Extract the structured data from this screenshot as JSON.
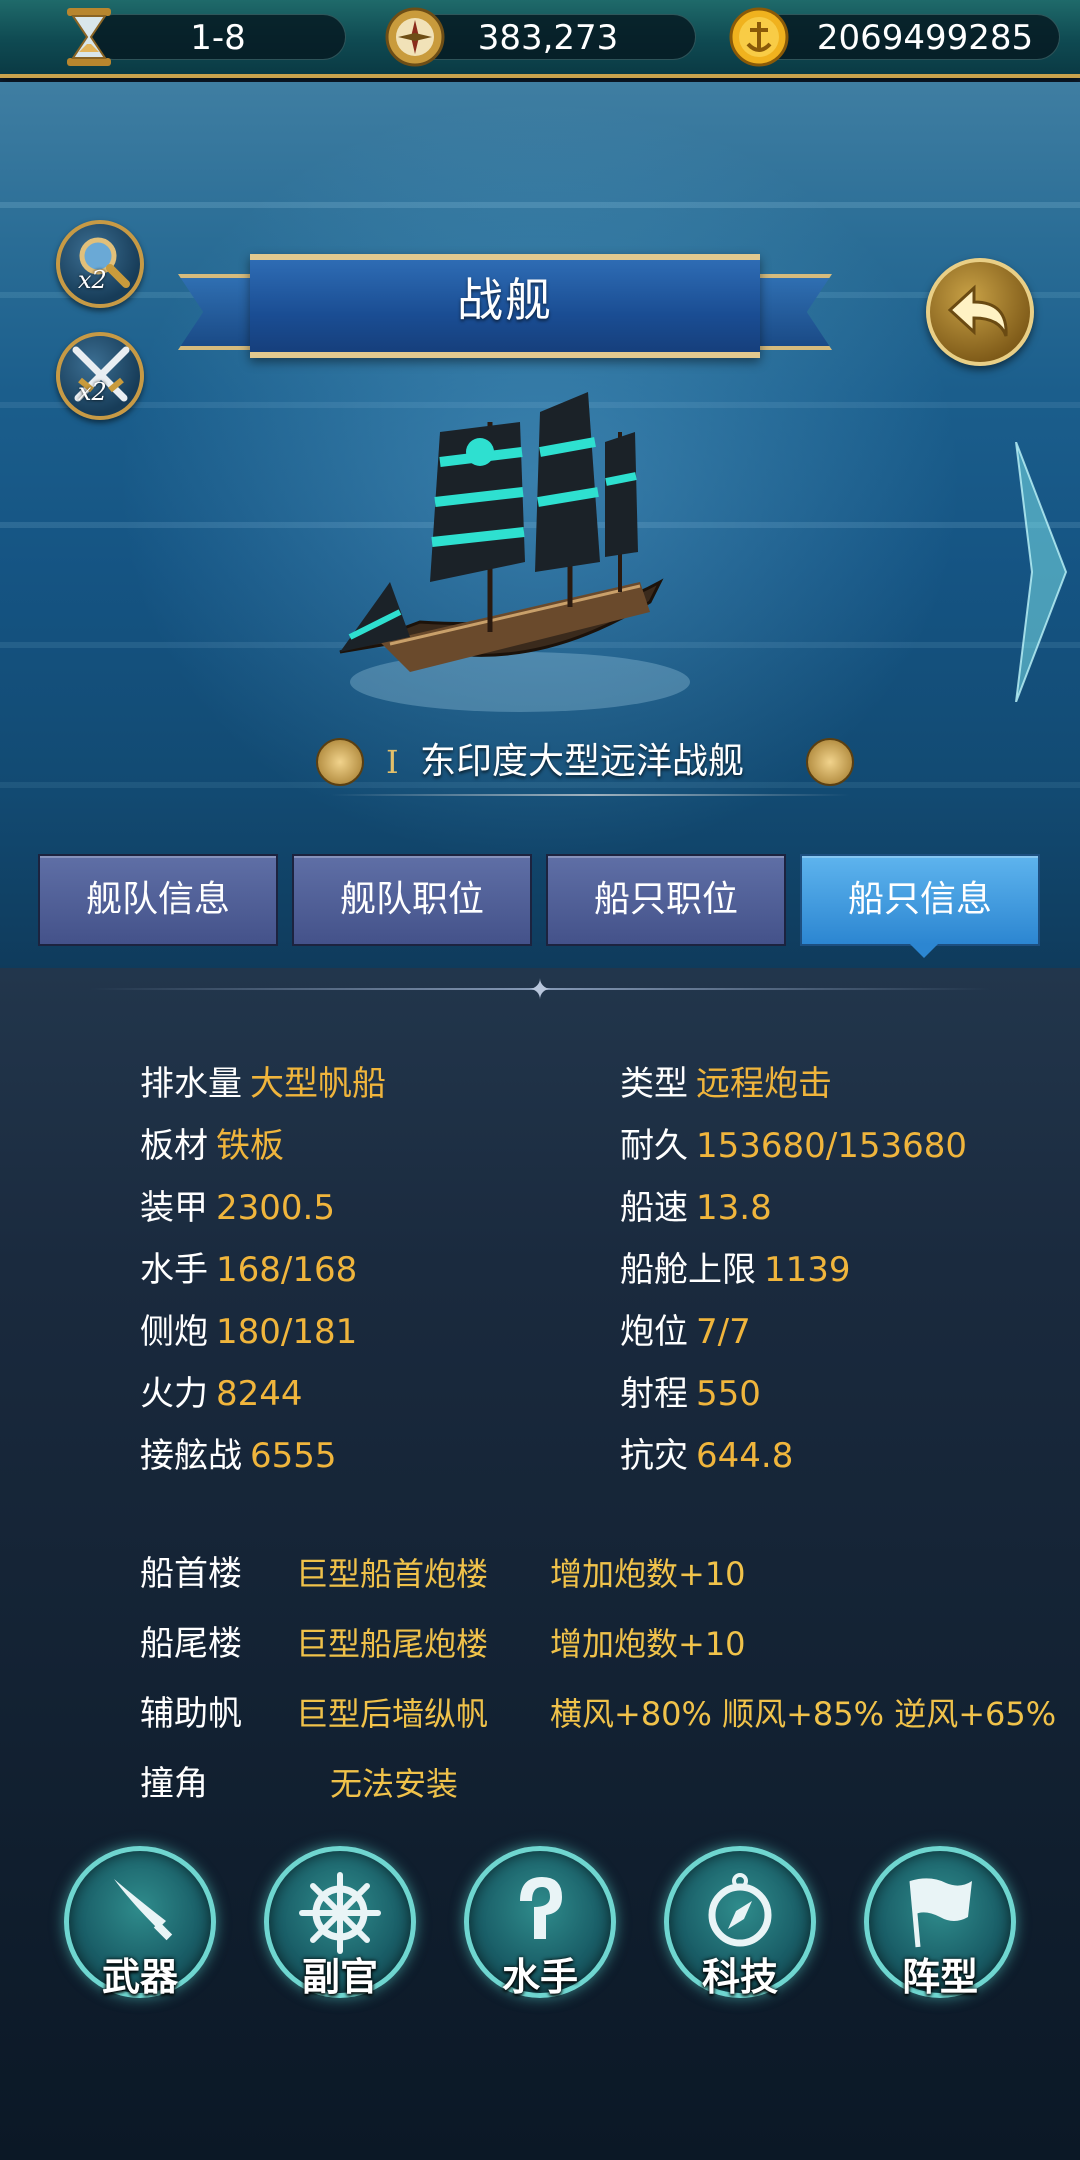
{
  "resources": {
    "stage": "1-8",
    "compass_value": "383,273",
    "gold_value": "2069499285"
  },
  "scene": {
    "speed_multiplier": "x2",
    "battle_multiplier": "x2",
    "title": "战舰",
    "ship_tier": "I",
    "ship_name": "东印度大型远洋战舰"
  },
  "tabs": [
    {
      "label": "舰队信息",
      "active": false
    },
    {
      "label": "舰队职位",
      "active": false
    },
    {
      "label": "船只职位",
      "active": false
    },
    {
      "label": "船只信息",
      "active": true
    }
  ],
  "stats_left": [
    {
      "key": "排水量",
      "value": "大型帆船"
    },
    {
      "key": "板材",
      "value": "铁板"
    },
    {
      "key": "装甲",
      "value": "2300.5"
    },
    {
      "key": "水手",
      "value": "168/168"
    },
    {
      "key": "侧炮",
      "value": "180/181"
    },
    {
      "key": "火力",
      "value": "8244"
    },
    {
      "key": "接舷战",
      "value": "6555"
    }
  ],
  "stats_right": [
    {
      "key": "类型",
      "value": "远程炮击"
    },
    {
      "key": "耐久",
      "value": "153680/153680"
    },
    {
      "key": "船速",
      "value": "13.8"
    },
    {
      "key": "船舱上限",
      "value": "1139"
    },
    {
      "key": "炮位",
      "value": "7/7"
    },
    {
      "key": "射程",
      "value": "550"
    },
    {
      "key": "抗灾",
      "value": "644.8"
    }
  ],
  "equipment": [
    {
      "slot": "船首楼",
      "name": "巨型船首炮楼",
      "effect": "增加炮数+10"
    },
    {
      "slot": "船尾楼",
      "name": "巨型船尾炮楼",
      "effect": "增加炮数+10"
    },
    {
      "slot": "辅助帆",
      "name": "巨型后墙纵帆",
      "effect": "横风+80%  顺风+85%  逆风+65%"
    },
    {
      "slot": "撞角",
      "name": "无法安装",
      "effect": ""
    }
  ],
  "bottom_buttons": [
    {
      "label": "武器",
      "icon": "sword-icon"
    },
    {
      "label": "副官",
      "icon": "ship-wheel-icon"
    },
    {
      "label": "水手",
      "icon": "hook-icon"
    },
    {
      "label": "科技",
      "icon": "compass-icon"
    },
    {
      "label": "阵型",
      "icon": "flag-icon"
    }
  ],
  "colors": {
    "stat_value": "#f0b53c",
    "tab_active": "#2c86d1",
    "tab_inactive": "#44528a",
    "accent_gold": "#c9a24d"
  }
}
